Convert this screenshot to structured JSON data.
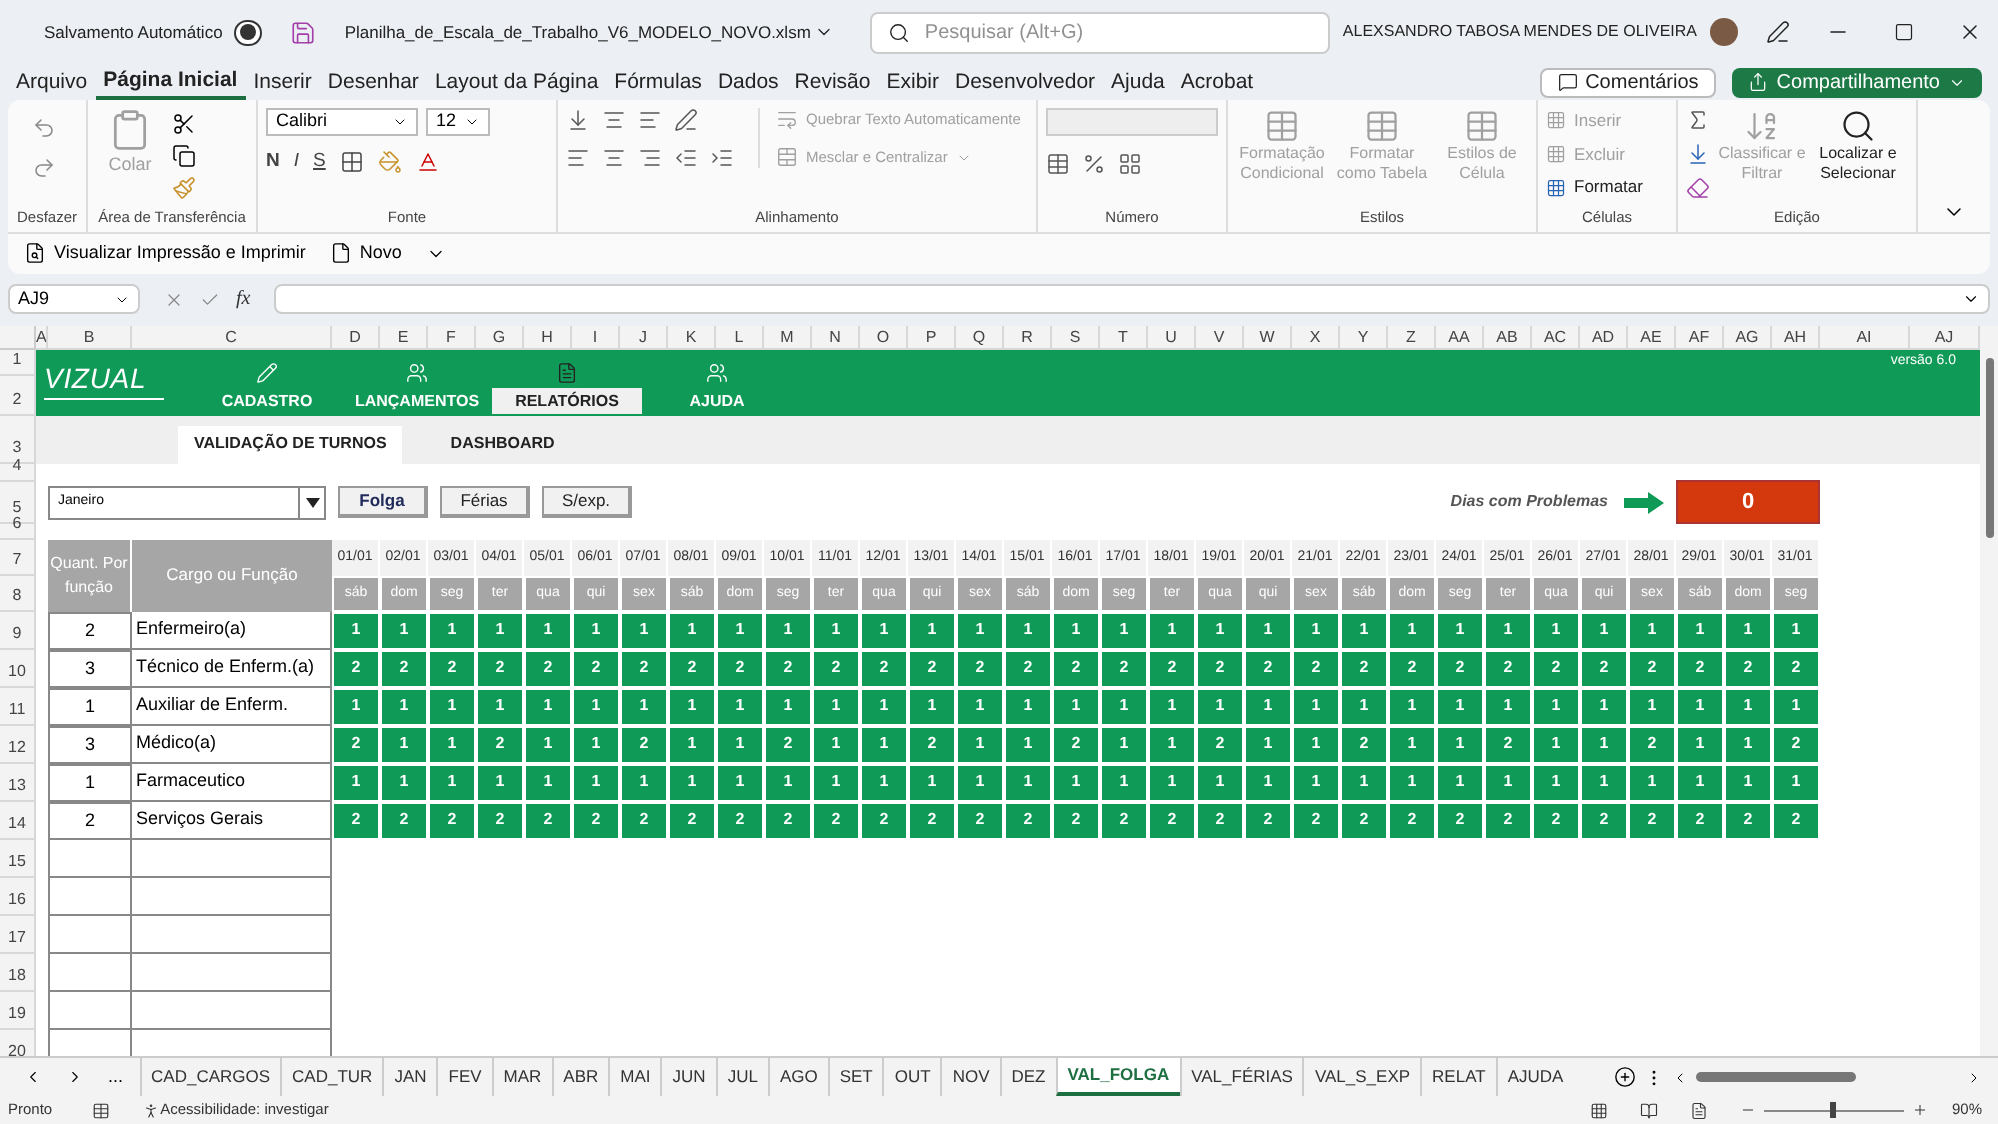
{
  "title_bar": {
    "autosave_label": "Salvamento Automático",
    "autosave_on": false,
    "file_name": "Planilha_de_Escala_de_Trabalho_V6_MODELO_NOVO.xlsm",
    "search_placeholder": "Pesquisar (Alt+G)",
    "user_name": "ALEXSANDRO TABOSA MENDES DE OLIVEIRA"
  },
  "menu_tabs": [
    {
      "label": "Arquivo",
      "selected": false
    },
    {
      "label": "Página Inicial",
      "selected": true
    },
    {
      "label": "Inserir",
      "selected": false
    },
    {
      "label": "Desenhar",
      "selected": false
    },
    {
      "label": "Layout da Página",
      "selected": false
    },
    {
      "label": "Fórmulas",
      "selected": false
    },
    {
      "label": "Dados",
      "selected": false
    },
    {
      "label": "Revisão",
      "selected": false
    },
    {
      "label": "Exibir",
      "selected": false
    },
    {
      "label": "Desenvolvedor",
      "selected": false
    },
    {
      "label": "Ajuda",
      "selected": false
    },
    {
      "label": "Acrobat",
      "selected": false
    }
  ],
  "comments_button": "Comentários",
  "share_button": "Compartilhamento",
  "ribbon": {
    "paste": {
      "label": "Colar",
      "disabled": true
    },
    "font_name": "Calibri",
    "font_size": "12",
    "format_buttons": [
      "N",
      "I",
      "S"
    ],
    "wrap_text": {
      "label": "Quebrar Texto Automaticamente",
      "disabled": true
    },
    "merge_center": {
      "label": "Mesclar e Centralizar",
      "disabled": true
    },
    "styles": [
      {
        "label": "Formatação Condicional",
        "disabled": true
      },
      {
        "label": "Formatar como Tabela",
        "disabled": true
      },
      {
        "label": "Estilos de Célula",
        "disabled": true
      }
    ],
    "cells": [
      {
        "label": "Inserir",
        "disabled": true
      },
      {
        "label": "Excluir",
        "disabled": true
      },
      {
        "label": "Formatar",
        "disabled": false
      }
    ],
    "editing": [
      {
        "label": "Classificar e Filtrar",
        "disabled": true
      },
      {
        "label": "Localizar e Selecionar",
        "disabled": false
      }
    ],
    "group_labels": [
      "Desfazer",
      "Área de Transferência",
      "Fonte",
      "Alinhamento",
      "Número",
      "Estilos",
      "Células",
      "Edição"
    ]
  },
  "quick_access": [
    "Visualizar Impressão e Imprimir",
    "Novo"
  ],
  "formula_bar": {
    "name_box": "AJ9",
    "function_label": "fx"
  },
  "column_letters": [
    "A",
    "B",
    "C",
    "D",
    "E",
    "F",
    "G",
    "H",
    "I",
    "J",
    "K",
    "L",
    "M",
    "N",
    "O",
    "P",
    "Q",
    "R",
    "S",
    "T",
    "U",
    "V",
    "W",
    "X",
    "Y",
    "Z",
    "AA",
    "AB",
    "AC",
    "AD",
    "AE",
    "AF",
    "AG",
    "AH",
    "AI",
    "AJ"
  ],
  "row_numbers": [
    "1",
    "2",
    "3",
    "4",
    "5",
    "6",
    "7",
    "8",
    "9",
    "10",
    "11",
    "12",
    "13",
    "14",
    "15",
    "16",
    "17",
    "18",
    "19",
    "20"
  ],
  "sheet": {
    "brand": "VIZUAL",
    "version": "versão 6.0",
    "nav_tabs": [
      {
        "label": "CADASTRO",
        "selected": false
      },
      {
        "label": "LANÇAMENTOS",
        "selected": false
      },
      {
        "label": "RELATÓRIOS",
        "selected": true
      },
      {
        "label": "AJUDA",
        "selected": false
      }
    ],
    "sub_tabs": [
      {
        "label": "VALIDAÇÃO DE TURNOS",
        "selected": true
      },
      {
        "label": "DASHBOARD",
        "selected": false
      }
    ],
    "month_select": "Janeiro",
    "filter_buttons": [
      {
        "label": "Folga",
        "selected": true
      },
      {
        "label": "Férias",
        "selected": false
      },
      {
        "label": "S/exp.",
        "selected": false
      }
    ],
    "problems_label": "Dias com Problemas",
    "problems_count": "0",
    "qty_header": "Quant. Por função",
    "role_header": "Cargo ou Função",
    "dates": [
      "01/01",
      "02/01",
      "03/01",
      "04/01",
      "05/01",
      "06/01",
      "07/01",
      "08/01",
      "09/01",
      "10/01",
      "11/01",
      "12/01",
      "13/01",
      "14/01",
      "15/01",
      "16/01",
      "17/01",
      "18/01",
      "19/01",
      "20/01",
      "21/01",
      "22/01",
      "23/01",
      "24/01",
      "25/01",
      "26/01",
      "27/01",
      "28/01",
      "29/01",
      "30/01",
      "31/01"
    ],
    "weekdays": [
      "sáb",
      "dom",
      "seg",
      "ter",
      "qua",
      "qui",
      "sex",
      "sáb",
      "dom",
      "seg",
      "ter",
      "qua",
      "qui",
      "sex",
      "sáb",
      "dom",
      "seg",
      "ter",
      "qua",
      "qui",
      "sex",
      "sáb",
      "dom",
      "seg",
      "ter",
      "qua",
      "qui",
      "sex",
      "sáb",
      "dom",
      "seg"
    ],
    "rows": [
      {
        "qty": "2",
        "role": "Enfermeiro(a)",
        "values": [
          "1",
          "1",
          "1",
          "1",
          "1",
          "1",
          "1",
          "1",
          "1",
          "1",
          "1",
          "1",
          "1",
          "1",
          "1",
          "1",
          "1",
          "1",
          "1",
          "1",
          "1",
          "1",
          "1",
          "1",
          "1",
          "1",
          "1",
          "1",
          "1",
          "1",
          "1"
        ]
      },
      {
        "qty": "3",
        "role": "Técnico de Enferm.(a)",
        "values": [
          "2",
          "2",
          "2",
          "2",
          "2",
          "2",
          "2",
          "2",
          "2",
          "2",
          "2",
          "2",
          "2",
          "2",
          "2",
          "2",
          "2",
          "2",
          "2",
          "2",
          "2",
          "2",
          "2",
          "2",
          "2",
          "2",
          "2",
          "2",
          "2",
          "2",
          "2"
        ]
      },
      {
        "qty": "1",
        "role": "Auxiliar de Enferm.",
        "values": [
          "1",
          "1",
          "1",
          "1",
          "1",
          "1",
          "1",
          "1",
          "1",
          "1",
          "1",
          "1",
          "1",
          "1",
          "1",
          "1",
          "1",
          "1",
          "1",
          "1",
          "1",
          "1",
          "1",
          "1",
          "1",
          "1",
          "1",
          "1",
          "1",
          "1",
          "1"
        ]
      },
      {
        "qty": "3",
        "role": "Médico(a)",
        "values": [
          "2",
          "1",
          "1",
          "2",
          "1",
          "1",
          "2",
          "1",
          "1",
          "2",
          "1",
          "1",
          "2",
          "1",
          "1",
          "2",
          "1",
          "1",
          "2",
          "1",
          "1",
          "2",
          "1",
          "1",
          "2",
          "1",
          "1",
          "2",
          "1",
          "1",
          "2"
        ]
      },
      {
        "qty": "1",
        "role": "Farmaceutico",
        "values": [
          "1",
          "1",
          "1",
          "1",
          "1",
          "1",
          "1",
          "1",
          "1",
          "1",
          "1",
          "1",
          "1",
          "1",
          "1",
          "1",
          "1",
          "1",
          "1",
          "1",
          "1",
          "1",
          "1",
          "1",
          "1",
          "1",
          "1",
          "1",
          "1",
          "1",
          "1"
        ]
      },
      {
        "qty": "2",
        "role": "Serviços Gerais",
        "values": [
          "2",
          "2",
          "2",
          "2",
          "2",
          "2",
          "2",
          "2",
          "2",
          "2",
          "2",
          "2",
          "2",
          "2",
          "2",
          "2",
          "2",
          "2",
          "2",
          "2",
          "2",
          "2",
          "2",
          "2",
          "2",
          "2",
          "2",
          "2",
          "2",
          "2",
          "2"
        ]
      }
    ]
  },
  "sheet_tabs": {
    "more": "...",
    "tabs": [
      {
        "label": "CAD_CARGOS",
        "selected": false
      },
      {
        "label": "CAD_TUR",
        "selected": false
      },
      {
        "label": "JAN",
        "selected": false
      },
      {
        "label": "FEV",
        "selected": false
      },
      {
        "label": "MAR",
        "selected": false
      },
      {
        "label": "ABR",
        "selected": false
      },
      {
        "label": "MAI",
        "selected": false
      },
      {
        "label": "JUN",
        "selected": false
      },
      {
        "label": "JUL",
        "selected": false
      },
      {
        "label": "AGO",
        "selected": false
      },
      {
        "label": "SET",
        "selected": false
      },
      {
        "label": "OUT",
        "selected": false
      },
      {
        "label": "NOV",
        "selected": false
      },
      {
        "label": "DEZ",
        "selected": false
      },
      {
        "label": "VAL_FOLGA",
        "selected": true
      },
      {
        "label": "VAL_FÉRIAS",
        "selected": false
      },
      {
        "label": "VAL_S_EXP",
        "selected": false
      },
      {
        "label": "RELAT",
        "selected": false
      },
      {
        "label": "AJUDA",
        "selected": false
      }
    ]
  },
  "status_bar": {
    "ready": "Pronto",
    "accessibility": "Acessibilidade: investigar",
    "zoom": {
      "level": 0.47,
      "reading": "90%"
    }
  }
}
